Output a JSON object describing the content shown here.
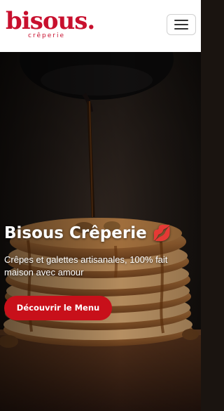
{
  "brand": {
    "name": "bisous.",
    "tagline": "crêperie"
  },
  "nav": {
    "toggle_icon": "hamburger-menu-icon"
  },
  "hero": {
    "title": "Bisous Crêperie",
    "emoji": "💋",
    "subtitle": "Crêpes et galettes artisanales, 100% fait maison avec amour",
    "cta_label": "Découvrir le Menu",
    "background_image": "stack-of-pancakes-with-syrup-pouring"
  },
  "colors": {
    "brand_red": "#c8102e",
    "cta_red": "#c8101a",
    "header_bg": "#ffffff"
  }
}
